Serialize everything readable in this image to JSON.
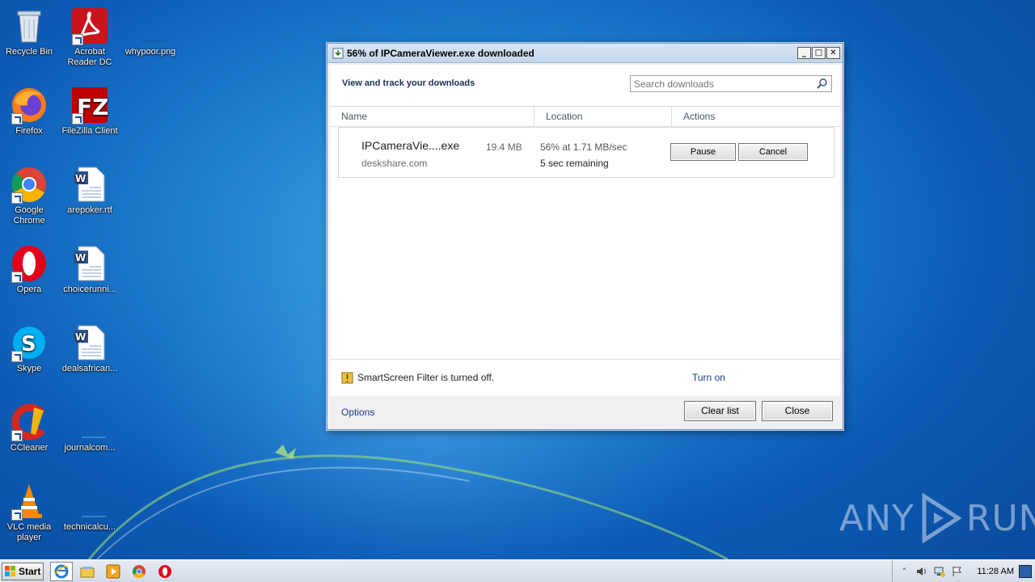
{
  "desktop": {
    "icons": [
      {
        "label": "Recycle Bin",
        "icon": "recycle-bin-icon"
      },
      {
        "label": "Acrobat Reader DC",
        "icon": "acrobat-icon"
      },
      {
        "label": "whypoor.png",
        "icon": "png-file-icon"
      },
      {
        "label": "Firefox",
        "icon": "firefox-icon"
      },
      {
        "label": "FileZilla Client",
        "icon": "filezilla-icon"
      },
      {
        "label": "Google Chrome",
        "icon": "chrome-icon"
      },
      {
        "label": "arepoker.rtf",
        "icon": "word-doc-icon"
      },
      {
        "label": "Opera",
        "icon": "opera-icon"
      },
      {
        "label": "choicerunni...",
        "icon": "word-doc-icon"
      },
      {
        "label": "Skype",
        "icon": "skype-icon"
      },
      {
        "label": "dealsafrican...",
        "icon": "word-doc-icon"
      },
      {
        "label": "CCleaner",
        "icon": "ccleaner-icon"
      },
      {
        "label": "journalcom...",
        "icon": "blank-file-icon"
      },
      {
        "label": "VLC media player",
        "icon": "vlc-icon"
      },
      {
        "label": "technicalcu...",
        "icon": "blank-file-icon"
      }
    ]
  },
  "window": {
    "title": "56% of IPCameraViewer.exe downloaded",
    "header": "View and track your downloads",
    "search_placeholder": "Search downloads",
    "columns": {
      "name": "Name",
      "location": "Location",
      "actions": "Actions"
    },
    "download": {
      "filename": "IPCameraVie....exe",
      "size": "19.4 MB",
      "domain": "deskshare.com",
      "progress_text": "56% at 1.71 MB/sec",
      "progress_percent": 56,
      "remaining": "5 sec remaining",
      "pause_label": "Pause",
      "cancel_label": "Cancel"
    },
    "smartscreen": {
      "text": "SmartScreen Filter is turned off.",
      "link": "Turn on"
    },
    "footer": {
      "options": "Options",
      "clear_label": "Clear list",
      "close_label": "Close"
    }
  },
  "taskbar": {
    "start_label": "Start",
    "apps": [
      "internet-explorer-icon",
      "file-explorer-icon",
      "media-player-icon",
      "chrome-icon",
      "opera-icon"
    ],
    "clock": "11:28 AM"
  },
  "watermark": {
    "text_left": "ANY",
    "text_right": "RUN"
  },
  "colors": {
    "accent": "#1a3b8c",
    "header_text": "#1c2e55",
    "desktop_bg": "#1e7fd0"
  }
}
